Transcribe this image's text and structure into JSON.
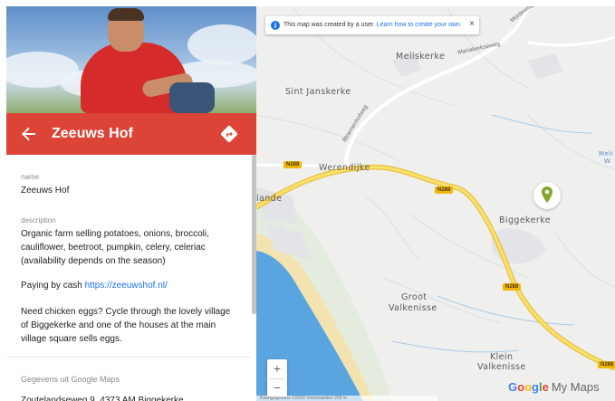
{
  "place": {
    "title": "Zeeuws Hof",
    "name_label": "name",
    "name_value": "Zeeuws Hof",
    "description_label": "description",
    "description": "Organic farm selling potatoes, onions, broccoli, cauliflower, beetroot, pumpkin, celery, celeriac (availability depends on the season)",
    "payment_text": "Paying by cash ",
    "payment_link": "https://zeeuwshof.nl/",
    "eggs_text": "Need chicken eggs? Cycle through the lovely village of Biggekerke and one of the houses at the main village square sells eggs.",
    "google_section_label": "Gegevens uit Google Maps",
    "address": "Zoutelandseweg 9, 4373 AM Biggekerke"
  },
  "map": {
    "notice_text": "This map was created by a user. ",
    "notice_link": "Learn how to create your own.",
    "notice_close": "×",
    "zoom_in": "+",
    "zoom_out": "−",
    "brand_google": "Google",
    "brand_mymaps": "My Maps",
    "attribution": "Kaartgegevens ©2020   Voorwaarden   200 m",
    "towns": {
      "meliskerke": "Meliskerke",
      "sint_janskerke": "Sint Janskerke",
      "werendijke": "Werendijke",
      "lande": "lande",
      "biggekerke": "Biggekerke",
      "groot": "Groot",
      "valkenisse1": "Valkenisse",
      "klein": "Klein",
      "valkenisse2": "Valkenisse",
      "meli_edge": "Meli",
      "wi_edge": "W"
    },
    "streets": {
      "manteweg": "Monteweg",
      "mariakerke": "Mariakerkseweg",
      "bloemenhofweg": "Bloemenhofweg"
    },
    "shields": [
      "N288",
      "N288",
      "N288",
      "N288"
    ],
    "colors": {
      "land": "#efefed",
      "sea": "#5aa4e0",
      "beach": "#f3e3b0",
      "road": "#f7d85a",
      "marker": "#7fa72a"
    }
  },
  "icons": {
    "back": "arrow-left-icon",
    "directions": "directions-icon",
    "info": "info-icon",
    "marker": "map-pin-icon"
  }
}
